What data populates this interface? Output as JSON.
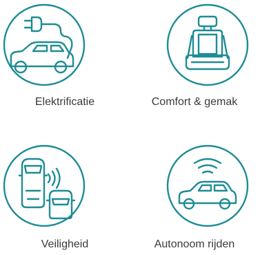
{
  "accent_color": "#1e8c94",
  "text_color": "#3a3a3a",
  "features": [
    {
      "label": "Elektrificatie",
      "icon": "electric-car-plug-icon"
    },
    {
      "label": "Comfort & gemak",
      "icon": "car-seat-icon"
    },
    {
      "label": "Veiligheid",
      "icon": "cars-sensor-icon"
    },
    {
      "label": "Autonoom rijden",
      "icon": "connected-car-icon"
    }
  ]
}
